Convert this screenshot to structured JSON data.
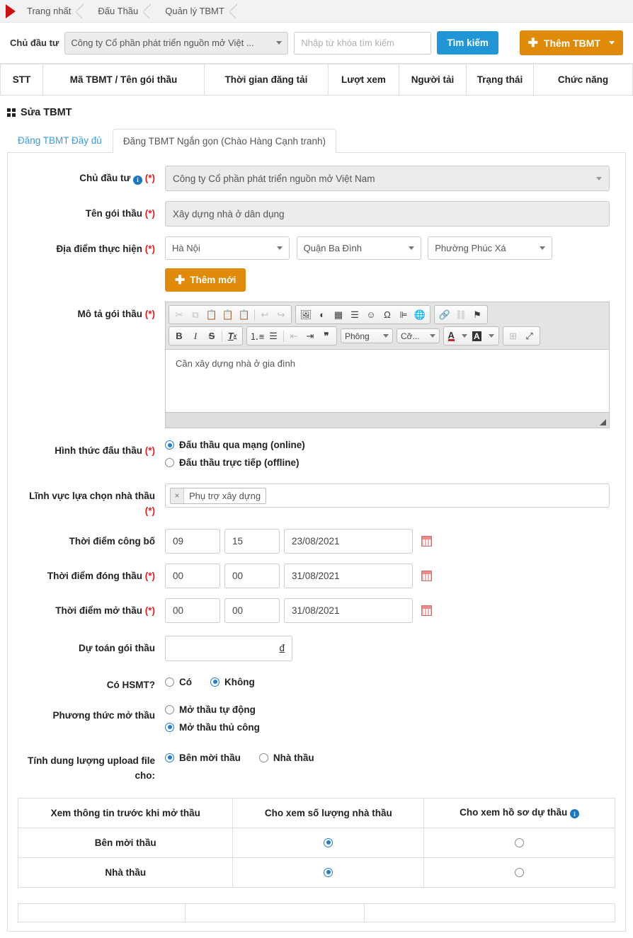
{
  "breadcrumb": {
    "items": [
      "Trang nhất",
      "Đấu Thầu",
      "Quản lý TBMT"
    ]
  },
  "search_bar": {
    "label": "Chủ đầu tư",
    "investor_selected": "Công ty Cổ phần phát triển nguồn mở Việt ...",
    "keyword_placeholder": "Nhập từ khóa tìm kiếm",
    "keyword_value": "",
    "search_button": "Tìm kiếm",
    "add_button": "Thêm TBMT",
    "accent_blue": "#2196d6",
    "accent_orange": "#e08a09"
  },
  "list_table": {
    "headers": [
      "STT",
      "Mã TBMT / Tên gói thầu",
      "Thời gian đăng tải",
      "Lượt xem",
      "Người tải",
      "Trạng thái",
      "Chức năng"
    ]
  },
  "section": {
    "title": "Sửa TBMT"
  },
  "tabs": [
    {
      "label": "Đăng TBMT Đầy đủ",
      "active": false
    },
    {
      "label": "Đăng TBMT Ngắn gọn (Chào Hàng Cạnh tranh)",
      "active": true
    }
  ],
  "form": {
    "investor": {
      "label": "Chủ đầu tư",
      "required": "(*)",
      "value": "Công ty Cổ phần phát triển nguồn mở Việt Nam"
    },
    "package_name": {
      "label": "Tên gói thầu",
      "required": "(*)",
      "value": "Xây dựng nhà ở dân dụng"
    },
    "location": {
      "label": "Địa điểm thực hiện",
      "required": "(*)",
      "province": "Hà Nội",
      "district": "Quận Ba Đình",
      "ward": "Phường Phúc Xá",
      "add_button": "Thêm mới"
    },
    "description": {
      "label": "Mô tả gói thầu",
      "required": "(*)",
      "content": "Cần xây dựng nhà ở gia đình",
      "toolbar": {
        "font_label": "Phông",
        "size_label": "Cỡ...",
        "bold": "B",
        "italic": "I",
        "strike": "S",
        "remove_format": "Tx"
      }
    },
    "bid_form": {
      "label": "Hình thức đấu thầu",
      "required": "(*)",
      "options": [
        {
          "label": "Đấu thầu qua mạng (online)",
          "selected": true
        },
        {
          "label": "Đấu thầu trực tiếp (offline)",
          "selected": false
        }
      ]
    },
    "field_select": {
      "label": "Lĩnh vực lựa chọn nhà thầu",
      "required": "(*)",
      "tags": [
        "Phụ trợ xây dựng"
      ]
    },
    "publish_time": {
      "label": "Thời điểm công bố",
      "required": "",
      "hour": "09",
      "minute": "15",
      "date": "23/08/2021"
    },
    "close_time": {
      "label": "Thời điểm đóng thầu",
      "required": "(*)",
      "hour": "00",
      "minute": "00",
      "date": "31/08/2021"
    },
    "open_time": {
      "label": "Thời điểm mở thầu",
      "required": "(*)",
      "hour": "00",
      "minute": "00",
      "date": "31/08/2021"
    },
    "estimate": {
      "label": "Dự toán gói thầu",
      "value": "",
      "unit": "đ"
    },
    "has_hsmt": {
      "label": "Có HSMT?",
      "options": [
        {
          "label": "Có",
          "selected": false
        },
        {
          "label": "Không",
          "selected": true
        }
      ]
    },
    "open_method": {
      "label": "Phương thức mở thầu",
      "options": [
        {
          "label": "Mở thầu tự động",
          "selected": false
        },
        {
          "label": "Mở thầu thủ công",
          "selected": true
        }
      ]
    },
    "upload_quota": {
      "label": "Tính dung lượng upload file cho:",
      "options": [
        {
          "label": "Bên mời thầu",
          "selected": true
        },
        {
          "label": "Nhà thầu",
          "selected": false
        }
      ]
    }
  },
  "perm_table": {
    "headers": [
      "Xem thông tin trước khi mở thầu",
      "Cho xem số lượng nhà thầu",
      "Cho xem hồ sơ dự thầu"
    ],
    "rows": [
      {
        "name": "Bên mời thầu",
        "count_selected": true,
        "doc_selected": false
      },
      {
        "name": "Nhà thầu",
        "count_selected": true,
        "doc_selected": false
      }
    ]
  }
}
